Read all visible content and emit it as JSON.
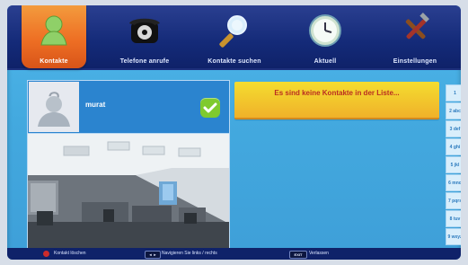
{
  "menu": {
    "items": [
      {
        "label": "Kontakte",
        "icon": "contact-person-icon",
        "active": true
      },
      {
        "label": "Telefone anrufe",
        "icon": "rotary-phone-icon",
        "active": false
      },
      {
        "label": "Kontakte suchen",
        "icon": "magnifier-icon",
        "active": false
      },
      {
        "label": "Aktuell",
        "icon": "clock-icon",
        "active": false
      },
      {
        "label": "Einstellungen",
        "icon": "tools-icon",
        "active": false
      }
    ]
  },
  "contact": {
    "name": "murat",
    "avatar_icon": "question-avatar-icon",
    "status_icon": "checkmark-icon"
  },
  "message": {
    "text": "Es sind keine Kontakte in der Liste..."
  },
  "alphabet": [
    "1",
    "2 abc",
    "3 def",
    "4 ghi",
    "5 jkl",
    "6 mno",
    "7 pqrs",
    "8 tuv",
    "9 wxyz"
  ],
  "footer": {
    "red": "Kontakt löschen",
    "arrows_key": "◄ ►",
    "arrows": "Navigieren Sie links / rechts",
    "exit_key": "EXIT",
    "exit": "Verlassen"
  },
  "colors": {
    "accent": "#f07a2a",
    "header": "#132a78",
    "background": "#45abe0",
    "message": "#f1c52b"
  }
}
